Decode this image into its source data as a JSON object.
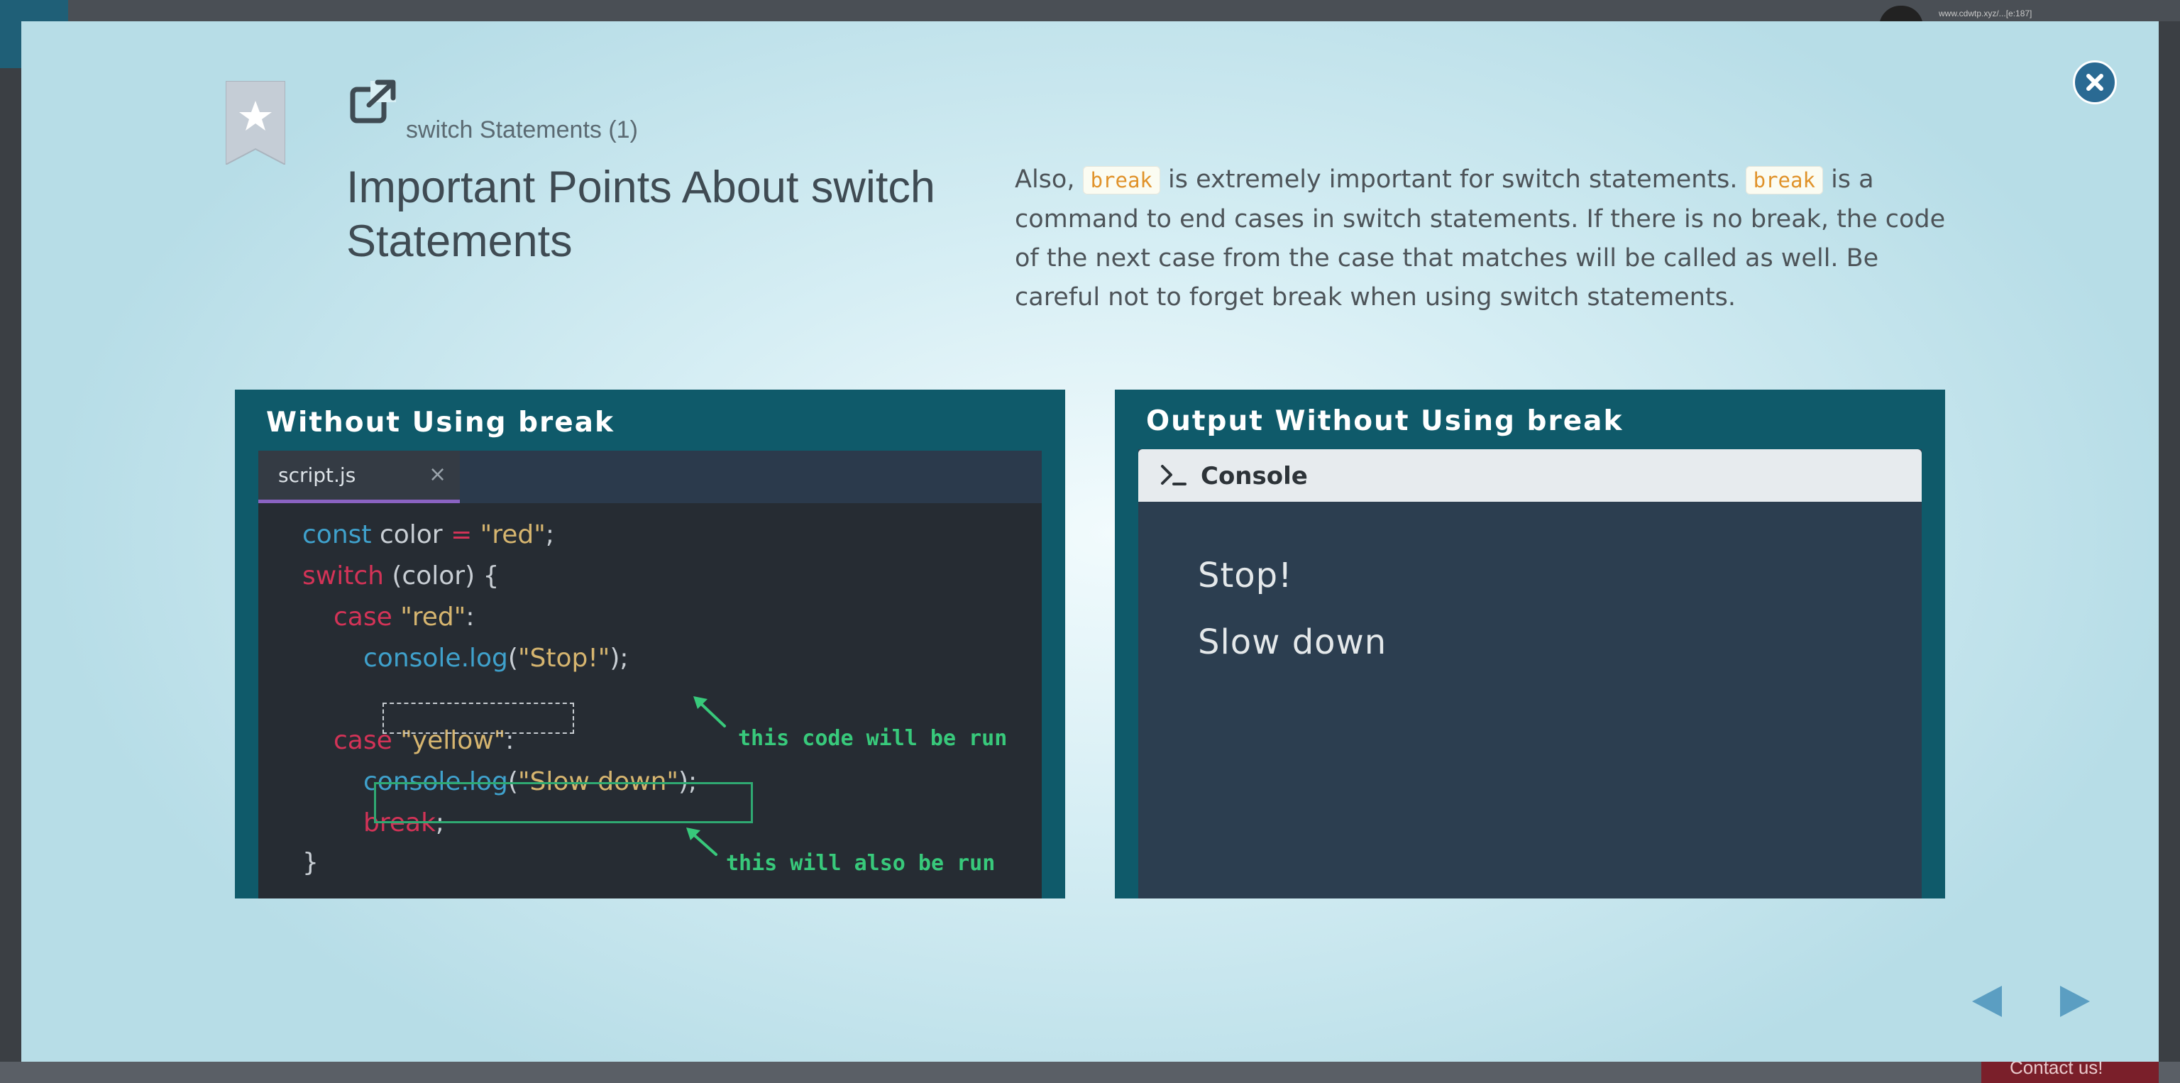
{
  "background": {
    "url_fragment": "www.cdwtp.xyz/...[e:187]",
    "contact_label": "Contact us!"
  },
  "header": {
    "lesson_link": "switch Statements (1)",
    "title": "Important Points About switch Statements"
  },
  "description": {
    "part1": "Also, ",
    "code1": "break",
    "part2": " is extremely important for switch statements. ",
    "code2": "break",
    "part3": " is a command to end cases in switch statements. If there is no break, the code of the next case from the case that matches will be called as well. Be careful not to forget break when using switch statements."
  },
  "left_panel": {
    "title": "Without Using break",
    "tab_name": "script.js",
    "tab_close": "×",
    "code": {
      "l1_kw": "const",
      "l1_rest": " color ",
      "l1_op": "=",
      "l1_str": " \"red\"",
      "l1_end": ";",
      "l2_kw": "switch",
      "l2_rest": " (color) {",
      "l3_kw": "case",
      "l3_str": " \"red\"",
      "l3_end": ":",
      "l4_fn": "console.log",
      "l4_open": "(",
      "l4_str": "\"Stop!\"",
      "l4_end": ");",
      "l5_kw": "case",
      "l5_str": " \"yellow\"",
      "l5_end": ":",
      "l6_fn": "console.log",
      "l6_open": "(",
      "l6_str": "\"Slow down\"",
      "l6_end": ");",
      "l7_kw": "break",
      "l7_end": ";",
      "l8": "}"
    },
    "annotation1": "this code will be run",
    "annotation2": "this will also be run"
  },
  "right_panel": {
    "title": "Output Without Using break",
    "console_title": "Console",
    "output": [
      "Stop!",
      "Slow down"
    ]
  },
  "colors": {
    "panel_bg": "#0f5a6a",
    "editor_bg": "#262c33",
    "keyword": "#d33357",
    "function": "#3fa1cc",
    "string": "#d6b56f",
    "annotation": "#38c97b",
    "close_button": "#2a6a93"
  },
  "icons": {
    "close": "close-icon",
    "bookmark": "bookmark-star-icon",
    "external": "external-link-icon",
    "prev": "arrow-left-icon",
    "next": "arrow-right-icon",
    "console": "terminal-prompt-icon"
  }
}
